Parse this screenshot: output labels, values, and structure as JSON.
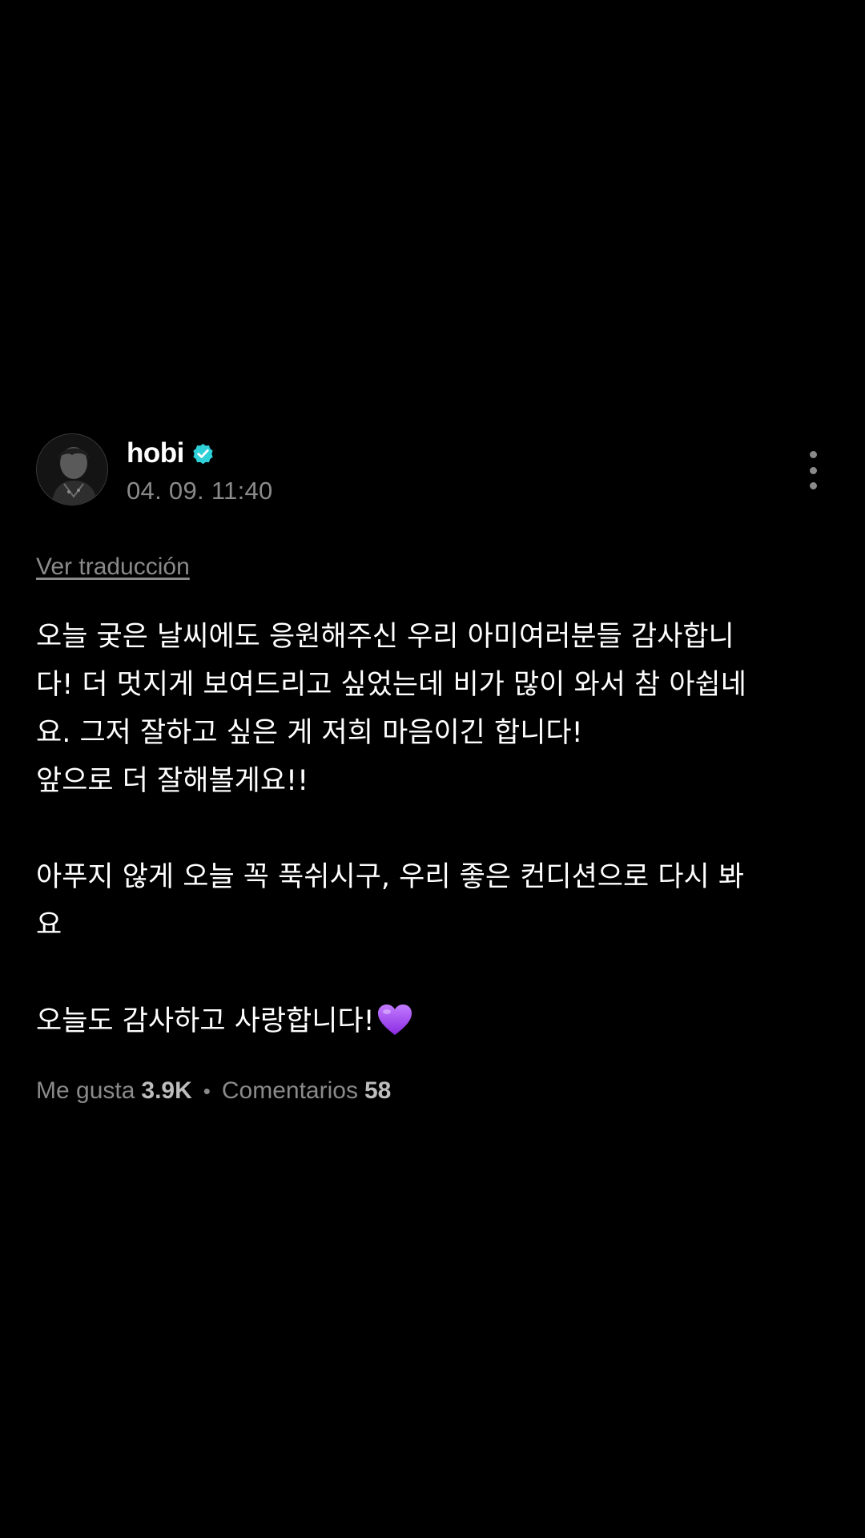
{
  "post": {
    "author": {
      "name": "hobi",
      "verified": true,
      "avatar_icon": "avatar-photo",
      "verified_icon": "verified-badge-icon",
      "verified_color": "#2fd1d9"
    },
    "timestamp": "04. 09. 11:40",
    "translate_label": "Ver traducción",
    "body": {
      "p1": {
        "l1": "오늘 궂은 날씨에도 응원해주신 우리 아미여러분들 감사합니",
        "l2": "다! 더 멋지게 보여드리고 싶었는데 비가 많이 와서 참 아쉽네",
        "l3": "요. 그저 잘하고 싶은 게 저희 마음이긴 합니다!",
        "l4": "앞으로 더 잘해볼게요!!"
      },
      "p2": {
        "l1": "아푸지 않게 오늘 꼭 푹쉬시구, 우리 좋은 컨디션으로 다시 봐",
        "l2": "요"
      },
      "p3": {
        "l1": "오늘도 감사하고 사랑합니다!",
        "emoji": "purple-heart-icon"
      }
    },
    "stats": {
      "likes_label": "Me gusta",
      "likes_value": "3.9K",
      "separator": "•",
      "comments_label": "Comentarios",
      "comments_value": "58"
    },
    "more_icon": "more-vertical-icon",
    "colors": {
      "background": "#000000",
      "text": "#ffffff",
      "muted": "#8a8a8a",
      "heart": "#a64dff"
    }
  }
}
